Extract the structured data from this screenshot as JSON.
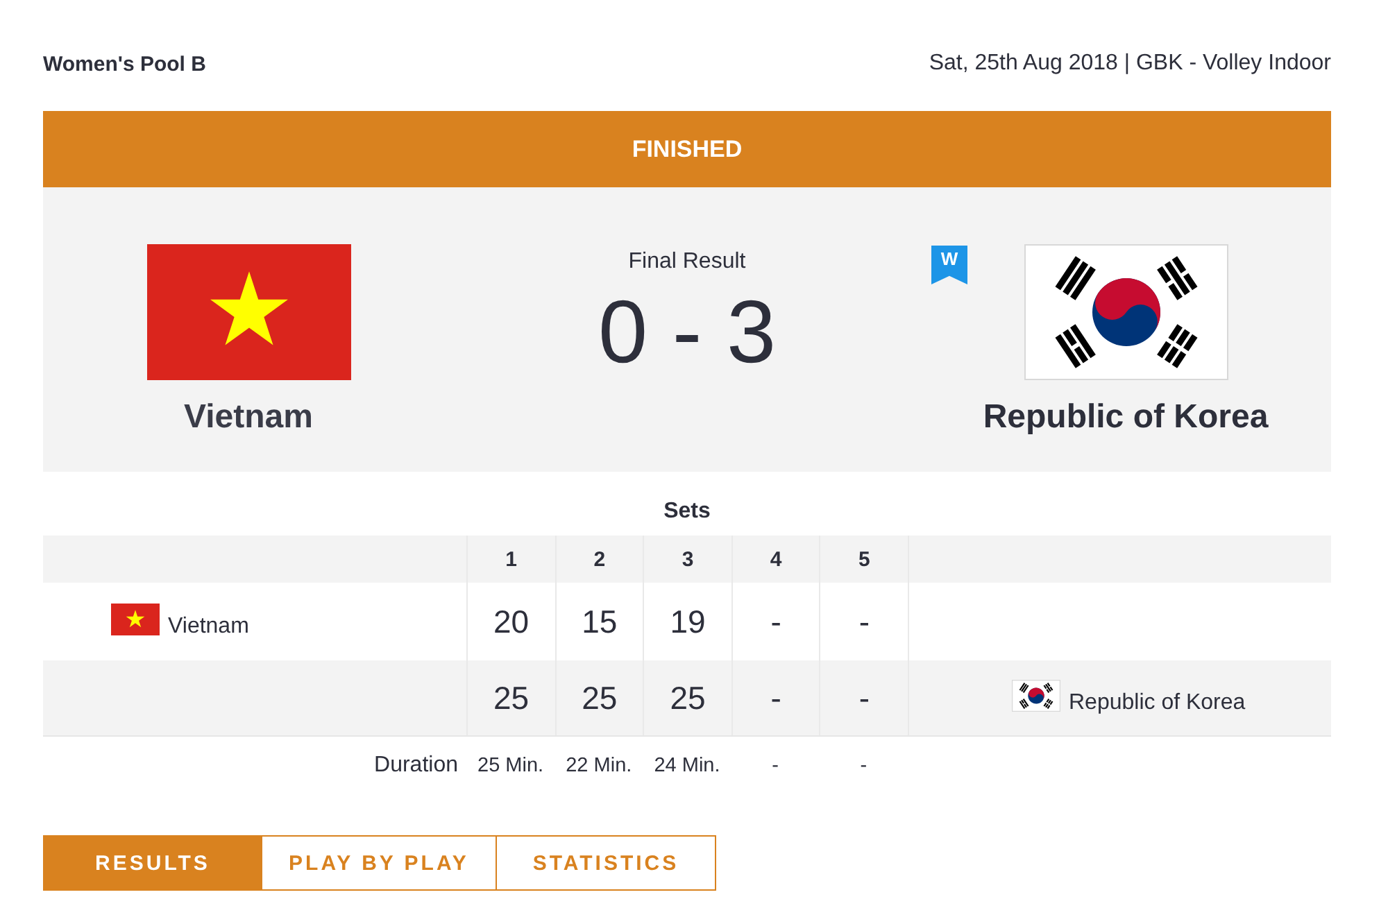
{
  "header": {
    "event": "Women's Pool B",
    "info": "Sat, 25th Aug 2018 | GBK - Volley Indoor"
  },
  "status": "FINISHED",
  "scoreboard": {
    "label": "Final Result",
    "score": "0 - 3",
    "winner_badge": "W",
    "teams": [
      {
        "name": "Vietnam",
        "kind": "vietnam",
        "winner": false
      },
      {
        "name": "Republic of Korea",
        "kind": "korea",
        "winner": true
      }
    ]
  },
  "sets": {
    "title": "Sets",
    "columns": [
      "1",
      "2",
      "3",
      "4",
      "5"
    ],
    "rows": [
      {
        "kind": "vietnam",
        "team": "Vietnam",
        "home": true,
        "scores": [
          "20",
          "15",
          "19",
          "-",
          "-"
        ]
      },
      {
        "kind": "korea",
        "team": "Republic of Korea",
        "home": false,
        "scores": [
          "25",
          "25",
          "25",
          "-",
          "-"
        ]
      }
    ],
    "duration": {
      "label": "Duration",
      "values": [
        "25 Min.",
        "22 Min.",
        "24 Min.",
        "-",
        "-"
      ]
    }
  },
  "tabs": [
    {
      "label": "RESULTS",
      "selected": true
    },
    {
      "label": "PLAY BY PLAY",
      "selected": false
    },
    {
      "label": "STATISTICS",
      "selected": false
    }
  ]
}
